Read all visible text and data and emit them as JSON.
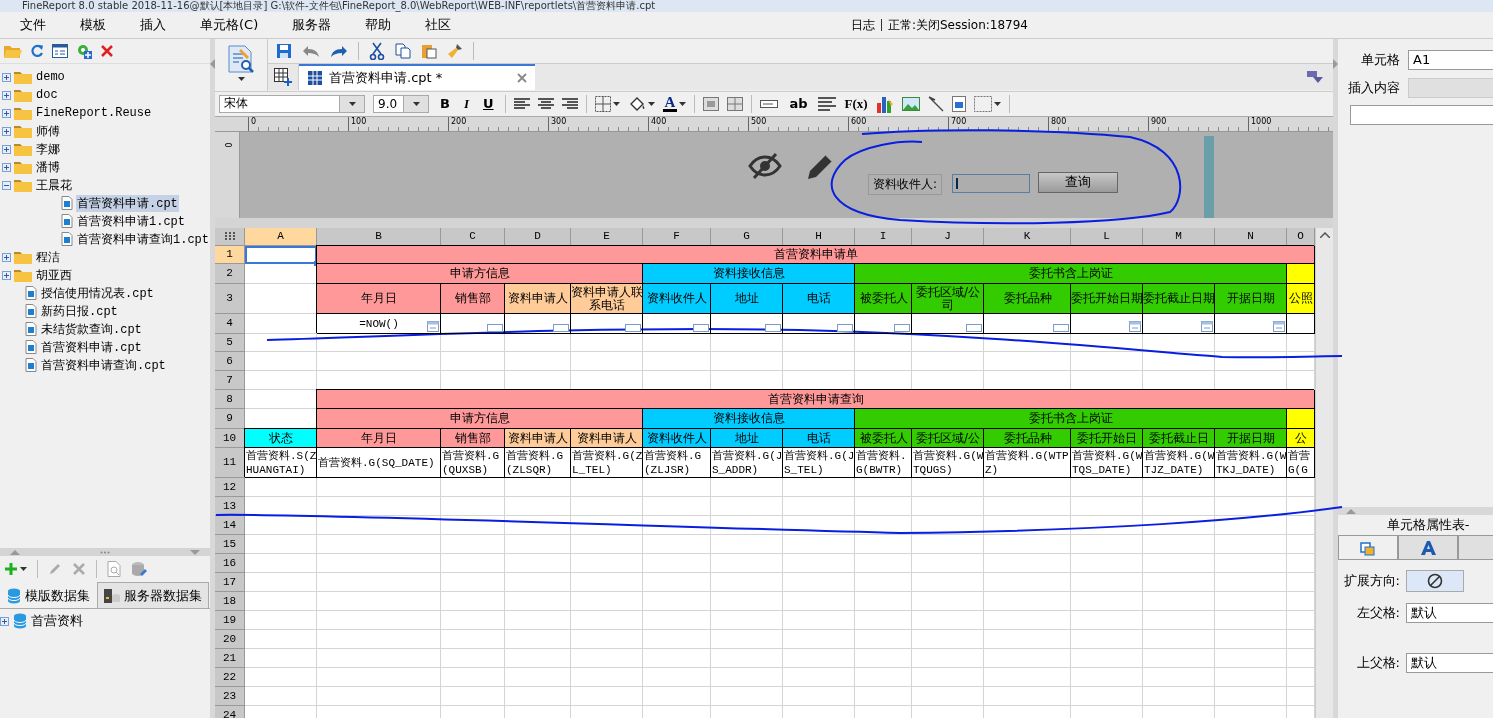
{
  "window": {
    "title": "FineReport 8.0 stable 2018-11-16@默认[本地目录]    G:\\软件-文件包\\FineReport_8.0\\WebReport\\WEB-INF\\reportlets\\首营资料申请.cpt"
  },
  "menu": [
    "文件",
    "模板",
    "插入",
    "单元格(C)",
    "服务器",
    "帮助",
    "社区"
  ],
  "status": {
    "log": "日志",
    "session": "正常:关闭Session:18794"
  },
  "file_tree": [
    {
      "label": "demo",
      "kind": "folder",
      "expanded": false,
      "selected": false
    },
    {
      "label": "doc",
      "kind": "folder",
      "expanded": false,
      "selected": false
    },
    {
      "label": "FineReport.Reuse",
      "kind": "folder",
      "expanded": false,
      "selected": false
    },
    {
      "label": "师傅",
      "kind": "folder",
      "expanded": false,
      "selected": false
    },
    {
      "label": "李娜",
      "kind": "folder",
      "expanded": false,
      "selected": false
    },
    {
      "label": "潘博",
      "kind": "folder",
      "expanded": false,
      "selected": false
    },
    {
      "label": "王晨花",
      "kind": "folder",
      "expanded": true,
      "selected": false,
      "children": [
        {
          "label": "首营资料申请.cpt",
          "kind": "file",
          "selected": true
        },
        {
          "label": "首营资料申请1.cpt",
          "kind": "file",
          "selected": false
        },
        {
          "label": "首营资料申请查询1.cpt",
          "kind": "file",
          "selected": false
        }
      ]
    },
    {
      "label": "程洁",
      "kind": "folder",
      "expanded": false,
      "selected": false
    },
    {
      "label": "胡亚西",
      "kind": "folder",
      "expanded": false,
      "selected": false
    },
    {
      "label": "授信使用情况表.cpt",
      "kind": "file",
      "selected": false
    },
    {
      "label": "新药日报.cpt",
      "kind": "file",
      "selected": false
    },
    {
      "label": "未结货款查询.cpt",
      "kind": "file",
      "selected": false
    },
    {
      "label": "首营资料申请.cpt",
      "kind": "file",
      "selected": false
    },
    {
      "label": "首营资料申请查询.cpt",
      "kind": "file",
      "selected": false
    }
  ],
  "dataset_tabs": [
    {
      "label": "模版数据集",
      "selected": true
    },
    {
      "label": "服务器数据集",
      "selected": false
    }
  ],
  "datasets": [
    {
      "label": "首营资料",
      "expanded": false
    }
  ],
  "doc_tabs": [
    {
      "label": "首营资料申请.cpt *",
      "selected": true
    }
  ],
  "format_toolbar": {
    "font": "宋体",
    "size": "9.0",
    "style_buttons": [
      "B",
      "I",
      "U"
    ],
    "font_color": "A",
    "text_tools": [
      "ab",
      "F(x)"
    ]
  },
  "ruler": {
    "marks": [
      "0",
      "100",
      "200",
      "300",
      "400",
      "500",
      "600",
      "700",
      "800",
      "900",
      "1000"
    ],
    "vertical": "0"
  },
  "parameters": {
    "label": "资料收件人:",
    "button": "查询"
  },
  "grid": {
    "columns": [
      {
        "label": "A",
        "selected": true
      },
      {
        "label": "B",
        "selected": false
      },
      {
        "label": "C",
        "selected": false
      },
      {
        "label": "D",
        "selected": false
      },
      {
        "label": "E",
        "selected": false
      },
      {
        "label": "F",
        "selected": false
      },
      {
        "label": "G",
        "selected": false
      },
      {
        "label": "H",
        "selected": false
      },
      {
        "label": "I",
        "selected": false
      },
      {
        "label": "J",
        "selected": false
      },
      {
        "label": "K",
        "selected": false
      },
      {
        "label": "L",
        "selected": false
      },
      {
        "label": "M",
        "selected": false
      },
      {
        "label": "N",
        "selected": false
      },
      {
        "label": "O",
        "selected": false
      }
    ],
    "rows": [
      {
        "label": "1",
        "selected": true,
        "cells": [
          {
            "kind": "blank",
            "selected": true
          },
          {
            "kind": "header",
            "text": "首营资料申请单",
            "color": "#ff9999"
          },
          {
            "kind": "covered"
          },
          {
            "kind": "covered"
          },
          {
            "kind": "covered"
          },
          {
            "kind": "covered"
          },
          {
            "kind": "covered"
          },
          {
            "kind": "covered"
          },
          {
            "kind": "covered"
          },
          {
            "kind": "covered"
          },
          {
            "kind": "covered"
          },
          {
            "kind": "covered"
          },
          {
            "kind": "covered"
          },
          {
            "kind": "covered"
          },
          {
            "kind": "covered"
          }
        ]
      },
      {
        "label": "2",
        "selected": false,
        "cells": [
          {
            "kind": "blank"
          },
          {
            "kind": "header",
            "text": "申请方信息",
            "color": "#ff9999"
          },
          {
            "kind": "covered"
          },
          {
            "kind": "covered"
          },
          {
            "kind": "covered"
          },
          {
            "kind": "header",
            "text": "资料接收信息",
            "color": "#00ccff"
          },
          {
            "kind": "covered"
          },
          {
            "kind": "covered"
          },
          {
            "kind": "header",
            "text": "委托书含上岗证",
            "color": "#33cc00"
          },
          {
            "kind": "covered"
          },
          {
            "kind": "covered"
          },
          {
            "kind": "covered"
          },
          {
            "kind": "covered"
          },
          {
            "kind": "covered"
          },
          {
            "kind": "header",
            "color": "#ffff00"
          }
        ]
      },
      {
        "label": "3",
        "selected": false,
        "cells": [
          {
            "kind": "blank"
          },
          {
            "kind": "header",
            "text": "年月日",
            "color": "#ff9999"
          },
          {
            "kind": "header",
            "text": "销售部",
            "color": "#ff9999"
          },
          {
            "kind": "header",
            "text": "资料申请人",
            "color": "#ffcc99"
          },
          {
            "kind": "header",
            "text": "资料申请人联系电话",
            "color": "#ffcc99"
          },
          {
            "kind": "header",
            "text": "资料收件人",
            "color": "#00ccff"
          },
          {
            "kind": "header",
            "text": "地址",
            "color": "#00ccff"
          },
          {
            "kind": "header",
            "text": "电话",
            "color": "#00ccff"
          },
          {
            "kind": "header",
            "text": "被委托人",
            "color": "#33cc00"
          },
          {
            "kind": "header",
            "text": "委托区域/公司",
            "color": "#33cc00"
          },
          {
            "kind": "header",
            "text": "委托品种",
            "color": "#33cc00"
          },
          {
            "kind": "header",
            "text": "委托开始日期",
            "color": "#33cc00"
          },
          {
            "kind": "header",
            "text": "委托截止日期",
            "color": "#33cc00"
          },
          {
            "kind": "header",
            "text": "开据日期",
            "color": "#33cc00"
          },
          {
            "kind": "header",
            "text": "公照",
            "color": "#ffff00"
          }
        ]
      },
      {
        "label": "4",
        "selected": false,
        "cells": [
          {
            "kind": "blank"
          },
          {
            "kind": "date-editor",
            "text": "=NOW()"
          },
          {
            "kind": "text-editor"
          },
          {
            "kind": "text-editor"
          },
          {
            "kind": "text-editor"
          },
          {
            "kind": "text-editor"
          },
          {
            "kind": "text-editor"
          },
          {
            "kind": "text-editor"
          },
          {
            "kind": "text-editor"
          },
          {
            "kind": "text-editor"
          },
          {
            "kind": "text-editor"
          },
          {
            "kind": "date-editor"
          },
          {
            "kind": "date-editor"
          },
          {
            "kind": "date-editor"
          },
          {
            "kind": "plain-editor"
          }
        ]
      },
      {
        "label": "5",
        "selected": false
      },
      {
        "label": "6",
        "selected": false
      },
      {
        "label": "7",
        "selected": false
      },
      {
        "label": "8",
        "selected": false,
        "cells": [
          {
            "kind": "blank"
          },
          {
            "kind": "header",
            "text": "首营资料申请查询",
            "color": "#ff9999"
          },
          {
            "kind": "covered"
          },
          {
            "kind": "covered"
          },
          {
            "kind": "covered"
          },
          {
            "kind": "covered"
          },
          {
            "kind": "covered"
          },
          {
            "kind": "covered"
          },
          {
            "kind": "covered"
          },
          {
            "kind": "covered"
          },
          {
            "kind": "covered"
          },
          {
            "kind": "covered"
          },
          {
            "kind": "covered"
          },
          {
            "kind": "covered"
          },
          {
            "kind": "covered"
          }
        ]
      },
      {
        "label": "9",
        "selected": false,
        "cells": [
          {
            "kind": "blank"
          },
          {
            "kind": "header",
            "text": "申请方信息",
            "color": "#ff9999"
          },
          {
            "kind": "covered"
          },
          {
            "kind": "covered"
          },
          {
            "kind": "covered"
          },
          {
            "kind": "header",
            "text": "资料接收信息",
            "color": "#00ccff"
          },
          {
            "kind": "covered"
          },
          {
            "kind": "covered"
          },
          {
            "kind": "header",
            "text": "委托书含上岗证",
            "color": "#33cc00"
          },
          {
            "kind": "covered"
          },
          {
            "kind": "covered"
          },
          {
            "kind": "covered"
          },
          {
            "kind": "covered"
          },
          {
            "kind": "covered"
          },
          {
            "kind": "header",
            "color": "#ffff00"
          }
        ]
      },
      {
        "label": "10",
        "selected": false,
        "cells": [
          {
            "kind": "header",
            "text": "状态",
            "color": "#00ffff"
          },
          {
            "kind": "header",
            "text": "年月日",
            "color": "#ff9999"
          },
          {
            "kind": "header",
            "text": "销售部",
            "color": "#ff9999"
          },
          {
            "kind": "header",
            "text": "资料申请人",
            "color": "#ffcc99"
          },
          {
            "kind": "header",
            "text": "资料申请人",
            "color": "#ffcc99"
          },
          {
            "kind": "header",
            "text": "资料收件人",
            "color": "#00ccff"
          },
          {
            "kind": "header",
            "text": "地址",
            "color": "#00ccff"
          },
          {
            "kind": "header",
            "text": "电话",
            "color": "#00ccff"
          },
          {
            "kind": "header",
            "text": "被委托人",
            "color": "#33cc00"
          },
          {
            "kind": "header",
            "text": "委托区域/公",
            "color": "#33cc00"
          },
          {
            "kind": "header",
            "text": "委托品种",
            "color": "#33cc00"
          },
          {
            "kind": "header",
            "text": "委托开始日",
            "color": "#33cc00"
          },
          {
            "kind": "header",
            "text": "委托截止日",
            "color": "#33cc00"
          },
          {
            "kind": "header",
            "text": "开据日期",
            "color": "#33cc00"
          },
          {
            "kind": "header",
            "text": "公",
            "color": "#ffff00"
          }
        ]
      },
      {
        "label": "11",
        "selected": false,
        "cells": [
          {
            "kind": "binding",
            "text": "首营资料.S(ZHUANGTAI)"
          },
          {
            "kind": "binding",
            "text": "首营资料.G(SQ_DATE)"
          },
          {
            "kind": "binding",
            "text": "首营资料.G(QUXSB)"
          },
          {
            "kind": "binding",
            "text": "首营资料.G(ZLSQR)"
          },
          {
            "kind": "binding",
            "text": "首营资料.G(ZL_TEL)"
          },
          {
            "kind": "binding",
            "text": "首营资料.G(ZLJSR)"
          },
          {
            "kind": "binding",
            "text": "首营资料.G(JS_ADDR)"
          },
          {
            "kind": "binding",
            "text": "首营资料.G(JS_TEL)"
          },
          {
            "kind": "binding",
            "text": "首营资料.G(BWTR)"
          },
          {
            "kind": "binding",
            "text": "首营资料.G(WTQUGS)"
          },
          {
            "kind": "binding",
            "text": "首营资料.G(WTPZ)"
          },
          {
            "kind": "binding",
            "text": "首营资料.G(WTQS_DATE)"
          },
          {
            "kind": "binding",
            "text": "首营资料.G(WTJZ_DATE)"
          },
          {
            "kind": "binding",
            "text": "首营资料.G(WTKJ_DATE)"
          },
          {
            "kind": "binding",
            "text": "首营G(G"
          }
        ]
      },
      {
        "label": "12",
        "selected": false
      },
      {
        "label": "13",
        "selected": false
      },
      {
        "label": "14",
        "selected": false
      },
      {
        "label": "15",
        "selected": false
      },
      {
        "label": "16",
        "selected": false
      },
      {
        "label": "17",
        "selected": false
      },
      {
        "label": "18",
        "selected": false
      },
      {
        "label": "19",
        "selected": false
      },
      {
        "label": "20",
        "selected": false
      },
      {
        "label": "21",
        "selected": false
      },
      {
        "label": "22",
        "selected": false
      },
      {
        "label": "23",
        "selected": false
      },
      {
        "label": "24",
        "selected": false
      }
    ]
  },
  "cell_panel": {
    "cell_label": "单元格",
    "cell_value": "A1",
    "insert_label": "插入内容",
    "insert_disabled": true
  },
  "properties": {
    "title": "单元格属性表-",
    "tabs": [
      {
        "kind": "expand",
        "selected": true
      },
      {
        "kind": "font",
        "selected": false
      },
      {
        "kind": "empty",
        "selected": false
      }
    ],
    "expand_label": "扩展方向:",
    "left_parent_label": "左父格:",
    "left_parent_value": "默认",
    "top_parent_label": "上父格:",
    "top_parent_value": "默认"
  },
  "annotations": [
    {
      "kind": "circle"
    },
    {
      "kind": "stroke"
    },
    {
      "kind": "stroke"
    }
  ]
}
